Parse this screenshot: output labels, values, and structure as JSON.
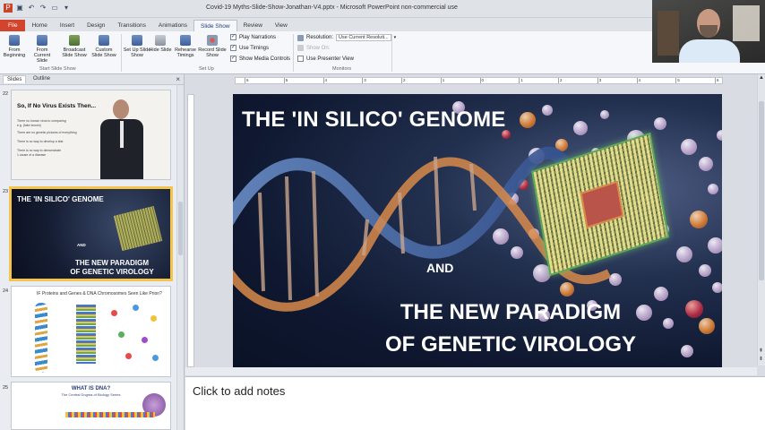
{
  "window": {
    "title": "Covid-19 Myths-Slide-Show-Jonathan-V4.pptx - Microsoft PowerPoint non-commercial use"
  },
  "quick_access": [
    "save-icon",
    "undo-icon",
    "redo-icon",
    "slideshow-icon",
    "customize-icon"
  ],
  "ribbon": {
    "tabs": [
      "File",
      "Home",
      "Insert",
      "Design",
      "Transitions",
      "Animations",
      "Slide Show",
      "Review",
      "View"
    ],
    "active_tab": "Slide Show",
    "buttons": {
      "from_beginning": "From Beginning",
      "from_current": "From Current Slide",
      "broadcast": "Broadcast Slide Show",
      "custom": "Custom Slide Show",
      "setup": "Set Up Slide Show",
      "hide": "Hide Slide",
      "rehearse": "Rehearse Timings",
      "record": "Record Slide Show"
    },
    "checkboxes": {
      "play_narrations": "Play Narrations",
      "use_timings": "Use Timings",
      "show_media_controls": "Show Media Controls",
      "use_presenter_view": "Use Presenter View"
    },
    "resolution_label": "Resolution:",
    "resolution_value": "Use Current Resoluti...",
    "show_on_label": "Show On:",
    "groups": {
      "start": "Start Slide Show",
      "setup": "Set Up",
      "monitors": "Monitors"
    }
  },
  "left_panel": {
    "tabs": [
      "Slides",
      "Outline"
    ],
    "active_tab": "Slides",
    "close": "×",
    "slides": [
      {
        "number": "22",
        "title": "So, If No Virus Exists Then...",
        "bullets": [
          "There no known virus to comparing",
          "e.g. (fake known)",
          "There are no genetic pictures of everything",
          "There is no way to develop a test",
          "There is no way to demonstrate",
          "1 cause of a disease"
        ]
      },
      {
        "number": "23",
        "title": "THE 'IN SILICO' GENOME",
        "and": "AND",
        "subtitle_1": "THE NEW PARADIGM",
        "subtitle_2": "OF GENETIC VIROLOGY"
      },
      {
        "number": "24",
        "title": "IF Proteins and Genes & DNA Chromosomes Seen Like Prion?"
      },
      {
        "number": "25",
        "title": "WHAT IS DNA?",
        "subtitle": "The Central Dogma of Biology Series"
      }
    ]
  },
  "ruler": {
    "labels": [
      "6",
      "5",
      "4",
      "3",
      "2",
      "1",
      "0",
      "1",
      "2",
      "3",
      "4",
      "5",
      "6"
    ]
  },
  "slide": {
    "title": "THE 'IN SILICO' GENOME",
    "and": "AND",
    "subtitle_line1": "THE NEW PARADIGM",
    "subtitle_line2": "OF GENETIC VIROLOGY"
  },
  "notes": {
    "placeholder": "Click to add notes"
  }
}
